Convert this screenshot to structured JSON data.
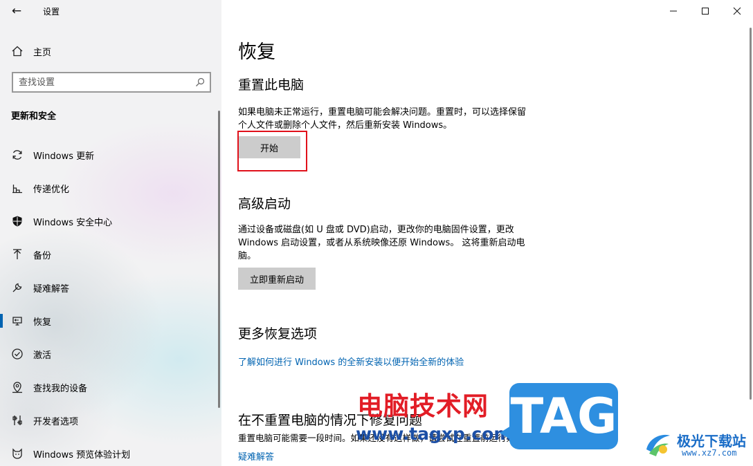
{
  "window": {
    "title": "设置",
    "controls": {
      "minimize": "minimize-icon",
      "maximize": "maximize-icon",
      "close": "close-icon"
    }
  },
  "sidebar": {
    "home_label": "主页",
    "search_placeholder": "查找设置",
    "section_title": "更新和安全",
    "active_item": "恢复",
    "items": [
      {
        "label": "Windows 更新",
        "icon": "sync-icon"
      },
      {
        "label": "传递优化",
        "icon": "delivery-optimization-icon"
      },
      {
        "label": "Windows 安全中心",
        "icon": "shield-icon"
      },
      {
        "label": "备份",
        "icon": "backup-arrow-icon"
      },
      {
        "label": "疑难解答",
        "icon": "wrench-icon"
      },
      {
        "label": "恢复",
        "icon": "recovery-icon"
      },
      {
        "label": "激活",
        "icon": "check-circle-icon"
      },
      {
        "label": "查找我的设备",
        "icon": "find-device-icon"
      },
      {
        "label": "开发者选项",
        "icon": "developer-icon"
      },
      {
        "label": "Windows 预览体验计划",
        "icon": "insider-cat-icon"
      }
    ]
  },
  "main": {
    "title": "恢复",
    "reset": {
      "heading": "重置此电脑",
      "description_line1": "如果电脑未正常运行，重置电脑可能会解决问题。重置时，可以选择保留",
      "description_line2": "个人文件或删除个人文件，然后重新安装 Windows。",
      "button": "开始"
    },
    "advanced": {
      "heading": "高级启动",
      "description_line1": "通过设备或磁盘(如 U 盘或 DVD)启动，更改你的电脑固件设置，更改",
      "description_line2": "Windows 启动设置，或者从系统映像还原 Windows。 这将重新启动电",
      "description_line3": "脑。",
      "button": "立即重新启动"
    },
    "more": {
      "heading": "更多恢复选项",
      "link": "了解如何进行 Windows 的全新安装以便开始全新的体验"
    },
    "fix": {
      "heading": "在不重置电脑的情况下修复问题",
      "description": "重置电脑可能需要一段时间。如果还没有这样做，请尝试在重置前运行疑难解答来解决问题。",
      "link": "疑难解答"
    }
  },
  "watermark": {
    "site_cn": "电脑技术网",
    "site_url": "www.tagxp.com",
    "tag": "TAG",
    "brand": "极光下载站",
    "brand_url": "www.xz7.com"
  },
  "colors": {
    "accent": "#0063b1",
    "highlight": "#e0101a",
    "watermark_red": "#e21d26",
    "watermark_blue": "#2e8fe0"
  }
}
